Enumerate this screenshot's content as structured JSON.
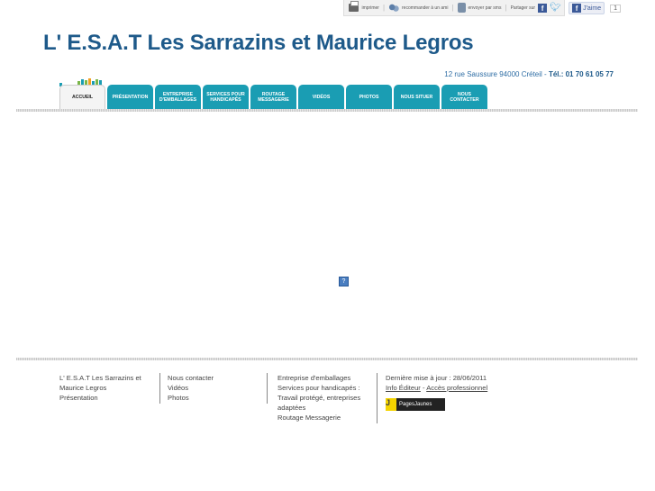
{
  "toolbar": {
    "print": "imprimer",
    "recommend": "recommander à un ami",
    "send": "envoyer par sms",
    "share": "Partager sur",
    "like": "J'aime",
    "like_count": "1"
  },
  "site": {
    "title": "L' E.S.A.T Les Sarrazins et Maurice Legros",
    "address": "12 rue Saussure 94000 Créteil",
    "tel_label": "Tél.: 01 70 61 05 77"
  },
  "nav": {
    "items": [
      {
        "label": "ACCUEIL"
      },
      {
        "label": "PRÉSENTATION"
      },
      {
        "label": "ENTREPRISE D'EMBALLAGES"
      },
      {
        "label": "SERVICES POUR HANDICAPÉS"
      },
      {
        "label": "ROUTAGE MESSAGERIE"
      },
      {
        "label": "VIDÉOS"
      },
      {
        "label": "PHOTOS"
      },
      {
        "label": "NOUS SITUER"
      },
      {
        "label": "NOUS CONTACTER"
      }
    ]
  },
  "footer": {
    "col1": [
      "L' E.S.A.T Les Sarrazins et",
      "Maurice Legros",
      "Présentation"
    ],
    "col2": [
      "Nous contacter",
      "Vidéos",
      "Photos"
    ],
    "col3": [
      "Entreprise d'emballages",
      "Services pour handicapés :",
      "Travail protégé, entreprises",
      "adaptées",
      "Routage Messagerie"
    ],
    "updated": "Dernière mise à jour : 28/06/2011",
    "info_editeur": "Info Éditeur",
    "acces_pro": "Accès professionnel",
    "pages_jaunes": "PagesJaunes",
    "pj_letter": "J"
  },
  "colors": {
    "title": "#1e5a8a",
    "nav_tab": "#1a9db3"
  }
}
